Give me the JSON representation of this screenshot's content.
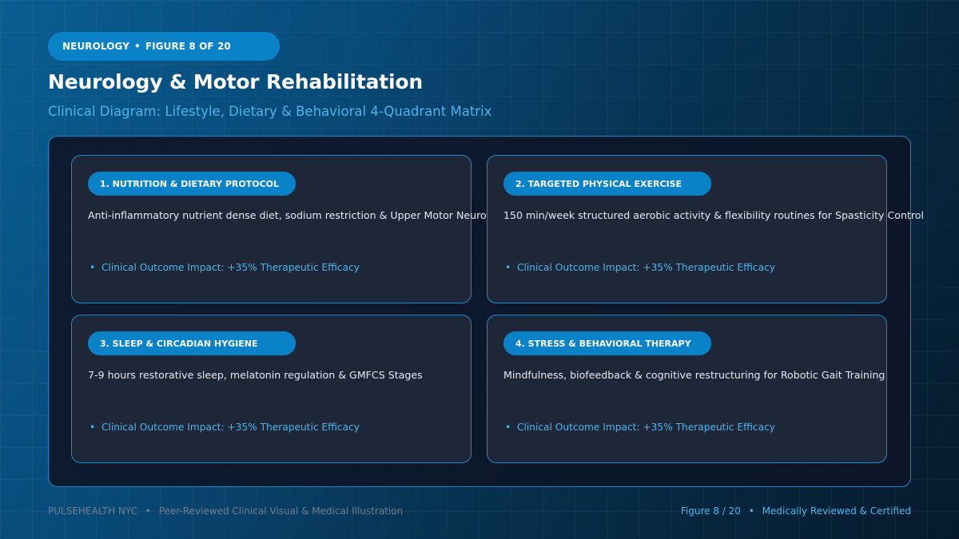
{
  "header": {
    "category_pill": "NEUROLOGY",
    "figure_pill": "FIGURE 8 OF 20",
    "separator": "•",
    "title": "Neurology & Motor Rehabilitation",
    "subtitle": "Clinical Diagram: Lifestyle, Dietary & Behavioral 4-Quadrant Matrix"
  },
  "quadrants": [
    {
      "tag": "1. NUTRITION & DIETARY PROTOCOL",
      "description": "Anti-inflammatory nutrient dense diet, sodium restriction & Upper Motor Neurons",
      "impact": "Clinical Outcome Impact: +35% Therapeutic Efficacy"
    },
    {
      "tag": "2. TARGETED PHYSICAL EXERCISE",
      "description": "150 min/week structured aerobic activity & flexibility routines for Spasticity Control",
      "impact": "Clinical Outcome Impact: +35% Therapeutic Efficacy"
    },
    {
      "tag": "3. SLEEP & CIRCADIAN HYGIENE",
      "description": "7-9 hours restorative sleep, melatonin regulation & GMFCS Stages",
      "impact": "Clinical Outcome Impact: +35% Therapeutic Efficacy"
    },
    {
      "tag": "4. STRESS & BEHAVIORAL THERAPY",
      "description": "Mindfulness, biofeedback & cognitive restructuring for Robotic Gait Training",
      "impact": "Clinical Outcome Impact: +35% Therapeutic Efficacy"
    }
  ],
  "footer": {
    "brand": "PULSEHEALTH NYC",
    "left_text": "Peer-Reviewed Clinical Visual & Medical Illustration",
    "figure_counter": "Figure 8 / 20",
    "right_text": "Medically Reviewed & Certified"
  },
  "colors": {
    "accent": "#0a82c8",
    "accent_text": "#4fb3ec",
    "card_bg": "#1d2738",
    "panel_bg": "#0e1628"
  }
}
